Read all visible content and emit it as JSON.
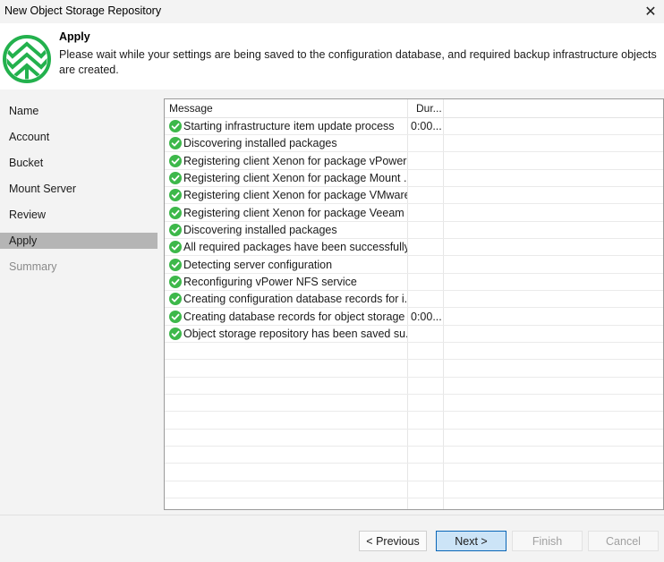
{
  "window": {
    "title": "New Object Storage Repository",
    "close_glyph": "✕"
  },
  "header": {
    "title": "Apply",
    "description": "Please wait while your settings are being saved to the configuration database, and required backup infrastructure objects are created.",
    "logo_icon": "veeam-logo-icon",
    "logo_color": "#23b14d"
  },
  "nav": {
    "items": [
      {
        "label": "Name",
        "state": "normal"
      },
      {
        "label": "Account",
        "state": "normal"
      },
      {
        "label": "Bucket",
        "state": "normal"
      },
      {
        "label": "Mount Server",
        "state": "normal"
      },
      {
        "label": "Review",
        "state": "normal"
      },
      {
        "label": "Apply",
        "state": "active"
      },
      {
        "label": "Summary",
        "state": "disabled"
      }
    ]
  },
  "log": {
    "columns": {
      "message": "Message",
      "duration": "Dur..."
    },
    "status_icon": "check-circle-icon",
    "status_color": "#3db84a",
    "rows": [
      {
        "message": "Starting infrastructure item update process",
        "duration": "0:00..."
      },
      {
        "message": "Discovering installed packages",
        "duration": ""
      },
      {
        "message": "Registering client Xenon for package vPower ...",
        "duration": ""
      },
      {
        "message": "Registering client Xenon for package Mount ...",
        "duration": ""
      },
      {
        "message": "Registering client Xenon for package VMware...",
        "duration": ""
      },
      {
        "message": "Registering client Xenon for package Veeam ...",
        "duration": ""
      },
      {
        "message": "Discovering installed packages",
        "duration": ""
      },
      {
        "message": "All required packages have been successfully ...",
        "duration": ""
      },
      {
        "message": "Detecting server configuration",
        "duration": ""
      },
      {
        "message": "Reconfiguring vPower NFS service",
        "duration": ""
      },
      {
        "message": "Creating configuration database records for i...",
        "duration": ""
      },
      {
        "message": "Creating database records for object storage ...",
        "duration": "0:00..."
      },
      {
        "message": "Object storage repository has been saved su...",
        "duration": ""
      }
    ]
  },
  "footer": {
    "previous": "< Previous",
    "next": "Next >",
    "finish": "Finish",
    "cancel": "Cancel"
  }
}
